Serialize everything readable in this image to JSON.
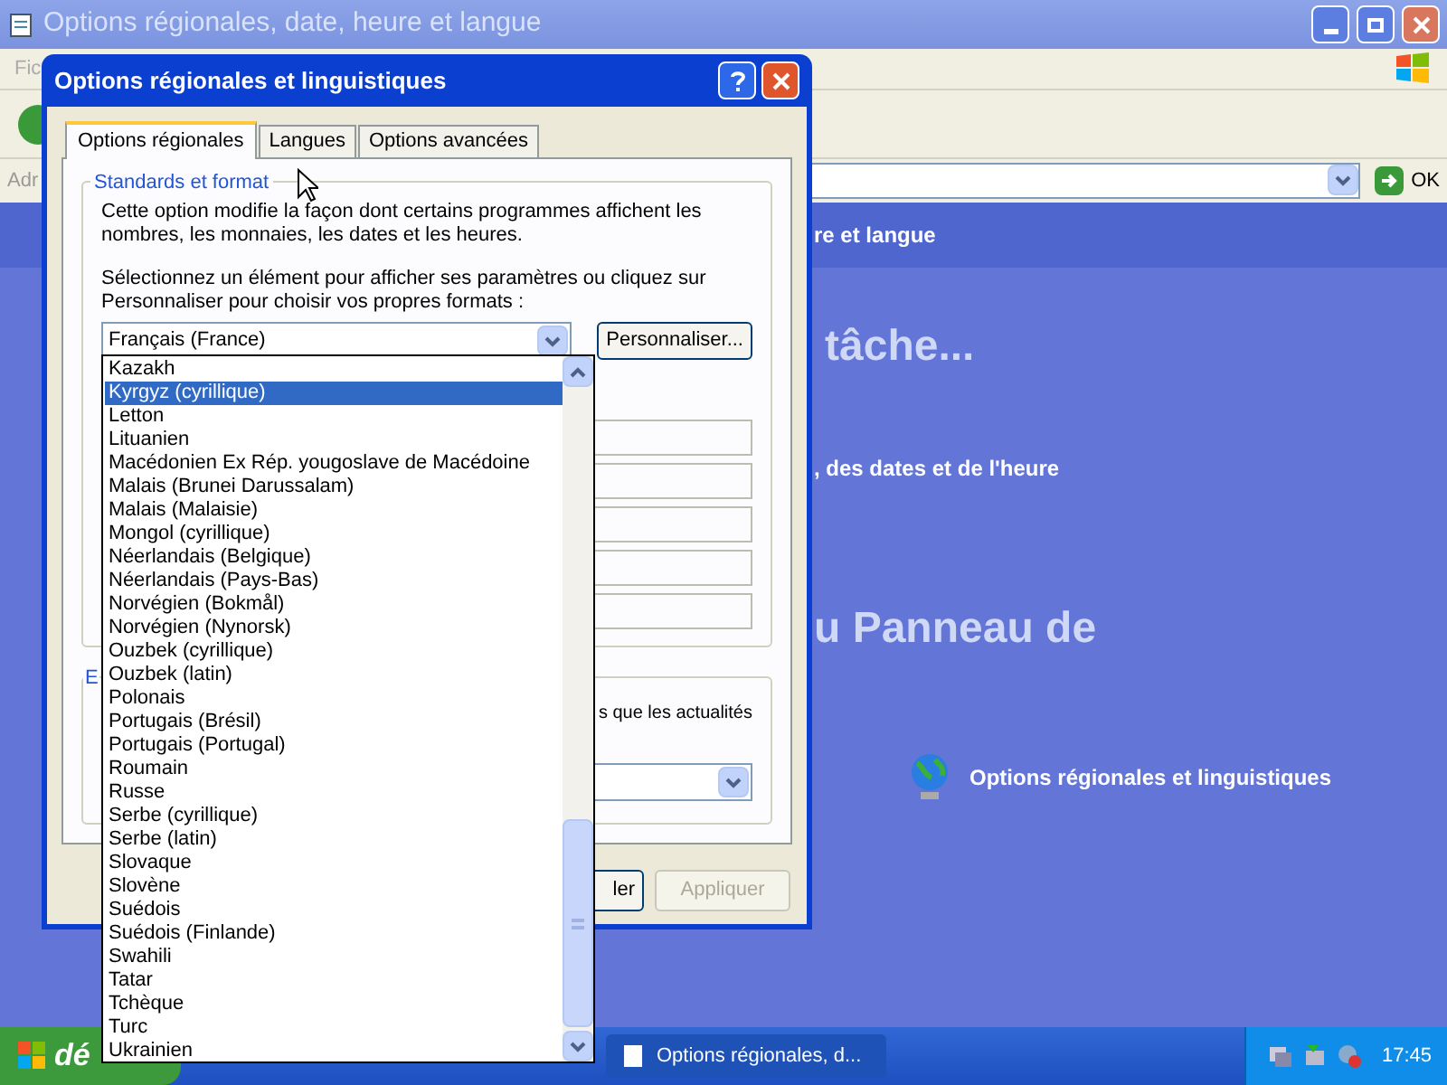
{
  "main_window": {
    "title": "Options régionales, date, heure et langue",
    "menu_fragment": "Fic",
    "address_fragment": "Adr",
    "go_label": "OK"
  },
  "content": {
    "header": "re et langue",
    "heading_1": "tâche...",
    "link_1": ", des dates et de l'heure",
    "heading_2": "u Panneau de",
    "icon_link": "Options régionales et linguistiques"
  },
  "dialog": {
    "title": "Options régionales et linguistiques",
    "tabs": [
      {
        "label": "Options régionales",
        "selected": true
      },
      {
        "label": "Langues",
        "selected": false
      },
      {
        "label": "Options avancées",
        "selected": false
      }
    ],
    "group_1": {
      "label": "Standards et format",
      "text_1": "Cette option modifie la façon dont certains programmes affichent les nombres, les monnaies, les dates et les heures.",
      "text_2": "Sélectionnez un élément pour afficher ses paramètres ou cliquez sur Personnaliser pour choisir vos propres formats :",
      "combo_value": "Français (France)",
      "customize_button": "Personnaliser..."
    },
    "group_2": {
      "label": "E",
      "text": "s que les actualités"
    },
    "buttons": [
      {
        "label": "ler",
        "disabled": false
      },
      {
        "label": "Appliquer",
        "disabled": true
      }
    ]
  },
  "dropdown_list": {
    "items": [
      {
        "label": "Kazakh",
        "selected": false
      },
      {
        "label": "Kyrgyz (cyrillique)",
        "selected": true
      },
      {
        "label": "Letton",
        "selected": false
      },
      {
        "label": "Lituanien",
        "selected": false
      },
      {
        "label": "Macédonien Ex Rép. yougoslave de Macédoine",
        "selected": false
      },
      {
        "label": "Malais (Brunei Darussalam)",
        "selected": false
      },
      {
        "label": "Malais (Malaisie)",
        "selected": false
      },
      {
        "label": "Mongol (cyrillique)",
        "selected": false
      },
      {
        "label": "Néerlandais (Belgique)",
        "selected": false
      },
      {
        "label": "Néerlandais (Pays-Bas)",
        "selected": false
      },
      {
        "label": "Norvégien (Bokmål)",
        "selected": false
      },
      {
        "label": "Norvégien (Nynorsk)",
        "selected": false
      },
      {
        "label": "Ouzbek (cyrillique)",
        "selected": false
      },
      {
        "label": "Ouzbek (latin)",
        "selected": false
      },
      {
        "label": "Polonais",
        "selected": false
      },
      {
        "label": "Portugais (Brésil)",
        "selected": false
      },
      {
        "label": "Portugais (Portugal)",
        "selected": false
      },
      {
        "label": "Roumain",
        "selected": false
      },
      {
        "label": "Russe",
        "selected": false
      },
      {
        "label": "Serbe (cyrillique)",
        "selected": false
      },
      {
        "label": "Serbe (latin)",
        "selected": false
      },
      {
        "label": "Slovaque",
        "selected": false
      },
      {
        "label": "Slovène",
        "selected": false
      },
      {
        "label": "Suédois",
        "selected": false
      },
      {
        "label": "Suédois (Finlande)",
        "selected": false
      },
      {
        "label": "Swahili",
        "selected": false
      },
      {
        "label": "Tatar",
        "selected": false
      },
      {
        "label": "Tchèque",
        "selected": false
      },
      {
        "label": "Turc",
        "selected": false
      },
      {
        "label": "Ukrainien",
        "selected": false
      }
    ]
  },
  "taskbar": {
    "start": "dé",
    "task": "Options régionales, d...",
    "clock": "17:45"
  }
}
